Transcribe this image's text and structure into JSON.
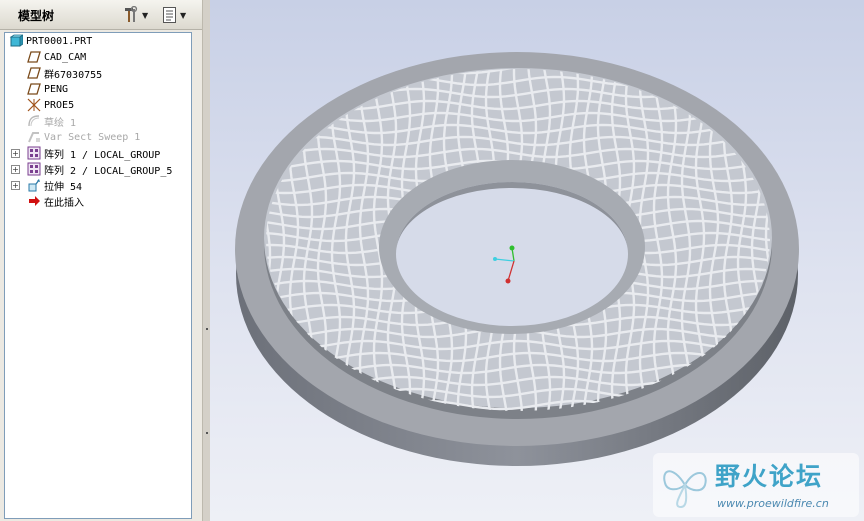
{
  "panel": {
    "title": "模型树",
    "tools_icon": "hammer-wrench-icon",
    "view_icon": "page-list-icon"
  },
  "tree": {
    "items": [
      {
        "label": "PRT0001.PRT",
        "icon": "part-cube-icon",
        "dim": false
      },
      {
        "label": "CAD_CAM",
        "icon": "datum-plane-icon",
        "dim": false
      },
      {
        "label": "群67030755",
        "icon": "datum-plane-icon",
        "dim": false
      },
      {
        "label": "PENG",
        "icon": "datum-plane-icon",
        "dim": false
      },
      {
        "label": "PROE5",
        "icon": "coordinate-system-icon",
        "dim": false
      },
      {
        "label": "草绘 1",
        "icon": "sketch-icon",
        "dim": true
      },
      {
        "label": "Var Sect Sweep 1",
        "icon": "sweep-icon",
        "dim": true
      },
      {
        "label": "阵列 1 / LOCAL_GROUP",
        "icon": "pattern-icon",
        "dim": false
      },
      {
        "label": "阵列 2 / LOCAL_GROUP_5",
        "icon": "pattern-icon",
        "dim": false
      },
      {
        "label": "拉伸 54",
        "icon": "extrude-icon",
        "dim": false
      },
      {
        "label": "在此插入",
        "icon": "insert-arrow-icon",
        "dim": false
      }
    ]
  },
  "watermark": {
    "title": "野火论坛",
    "url": "www.proewildfire.cn"
  },
  "colors": {
    "part_gray": "#a3a6ad",
    "tree_border": "#7f9db9",
    "insert_red": "#d01010"
  }
}
